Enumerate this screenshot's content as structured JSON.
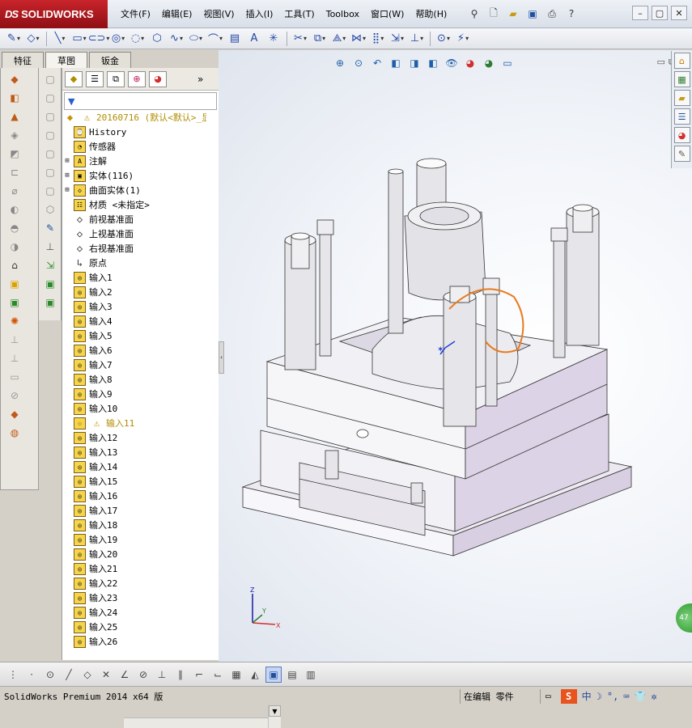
{
  "app": {
    "brand": "SOLIDWORKS",
    "brand_prefix": "DS"
  },
  "menu": [
    "文件(F)",
    "编辑(E)",
    "视图(V)",
    "插入(I)",
    "工具(T)",
    "Toolbox",
    "窗口(W)",
    "帮助(H)"
  ],
  "quick_icons": [
    "pin-icon",
    "new-document-icon",
    "open-folder-icon",
    "save-icon",
    "print-icon",
    "help-icon"
  ],
  "tabs": [
    "特征",
    "草图",
    "钣金"
  ],
  "active_tab": "草图",
  "tree": {
    "root": "20160716  (默认<默认>_显",
    "items": [
      {
        "label": "History",
        "icon": "history-icon",
        "expandable": false
      },
      {
        "label": "传感器",
        "icon": "sensor-icon",
        "expandable": false
      },
      {
        "label": "注解",
        "icon": "annotation-icon",
        "expandable": true
      },
      {
        "label": "实体(116)",
        "icon": "solid-bodies-icon",
        "expandable": true
      },
      {
        "label": "曲面实体(1)",
        "icon": "surface-bodies-icon",
        "expandable": true
      },
      {
        "label": "材质 <未指定>",
        "icon": "material-icon",
        "expandable": false
      },
      {
        "label": "前视基准面",
        "icon": "plane-icon",
        "expandable": false
      },
      {
        "label": "上视基准面",
        "icon": "plane-icon",
        "expandable": false
      },
      {
        "label": "右视基准面",
        "icon": "plane-icon",
        "expandable": false
      },
      {
        "label": "原点",
        "icon": "origin-icon",
        "expandable": false
      },
      {
        "label": "输入1",
        "icon": "imported-body-icon"
      },
      {
        "label": "输入2",
        "icon": "imported-body-icon"
      },
      {
        "label": "输入3",
        "icon": "imported-body-icon"
      },
      {
        "label": "输入4",
        "icon": "imported-body-icon"
      },
      {
        "label": "输入5",
        "icon": "imported-body-icon"
      },
      {
        "label": "输入6",
        "icon": "imported-body-icon"
      },
      {
        "label": "输入7",
        "icon": "imported-body-icon"
      },
      {
        "label": "输入8",
        "icon": "imported-body-icon"
      },
      {
        "label": "输入9",
        "icon": "imported-body-icon"
      },
      {
        "label": "输入10",
        "icon": "imported-body-icon"
      },
      {
        "label": "输入11",
        "icon": "imported-body-icon",
        "warning": true
      },
      {
        "label": "输入12",
        "icon": "imported-body-icon"
      },
      {
        "label": "输入13",
        "icon": "imported-body-icon"
      },
      {
        "label": "输入14",
        "icon": "imported-body-icon"
      },
      {
        "label": "输入15",
        "icon": "imported-body-icon"
      },
      {
        "label": "输入16",
        "icon": "imported-body-icon"
      },
      {
        "label": "输入17",
        "icon": "imported-body-icon"
      },
      {
        "label": "输入18",
        "icon": "imported-body-icon"
      },
      {
        "label": "输入19",
        "icon": "imported-body-icon"
      },
      {
        "label": "输入20",
        "icon": "imported-body-icon"
      },
      {
        "label": "输入21",
        "icon": "imported-body-icon"
      },
      {
        "label": "输入22",
        "icon": "imported-body-icon"
      },
      {
        "label": "输入23",
        "icon": "imported-body-icon"
      },
      {
        "label": "输入24",
        "icon": "imported-body-icon"
      },
      {
        "label": "输入25",
        "icon": "imported-body-icon"
      },
      {
        "label": "输入26",
        "icon": "imported-body-icon"
      }
    ]
  },
  "triad": {
    "x": "X",
    "y": "Y",
    "z": "Z"
  },
  "badge": "47",
  "status": {
    "app": "SolidWorks Premium 2014 x64 版",
    "mode": "在编辑 零件"
  },
  "ime": {
    "logo": "S",
    "lang": "中"
  },
  "colors": {
    "brand_red": "#c9242b",
    "selection_orange": "#e87a1c",
    "body_lilac": "#ddd3e6"
  }
}
